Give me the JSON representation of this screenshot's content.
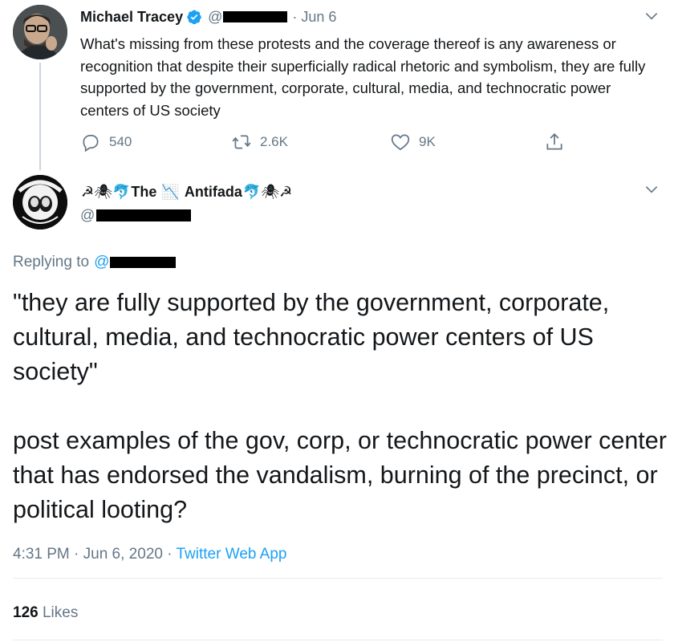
{
  "parent_tweet": {
    "name": "Michael Tracey",
    "handle_prefix": "@",
    "date": "· Jun 6",
    "text": "What's missing from these protests and the coverage thereof is any awareness or recognition that despite their superficially radical rhetoric and symbolism, they are fully supported by the government, corporate, cultural, media, and technocratic power centers of US society",
    "replies": "540",
    "retweets": "2.6K",
    "likes": "9K"
  },
  "main_tweet": {
    "name_prefix_emoji": "☭🕷🐬",
    "name_word1": "The",
    "name_mid_emoji": "📉",
    "name_word2": "Antifada",
    "name_suffix_emoji": "🐬🕷☭",
    "handle_prefix": "@",
    "replying_label": "Replying to",
    "replying_at": "@",
    "text_p1": "\"they are fully supported by the government, corporate, cultural, media, and technocratic power centers of US society\"",
    "text_p2": "post examples of the gov, corp, or technocratic power center that has endorsed the vandalism, burning of the precinct, or political looting?",
    "timestamp": "4:31 PM · Jun 6, 2020 · ",
    "source": "Twitter Web App",
    "likes_count": "126",
    "likes_label": "Likes"
  },
  "colors": {
    "accent": "#1da1f2",
    "secondary_text": "#657786",
    "primary_text": "#14171a",
    "divider": "#e6ecf0"
  }
}
